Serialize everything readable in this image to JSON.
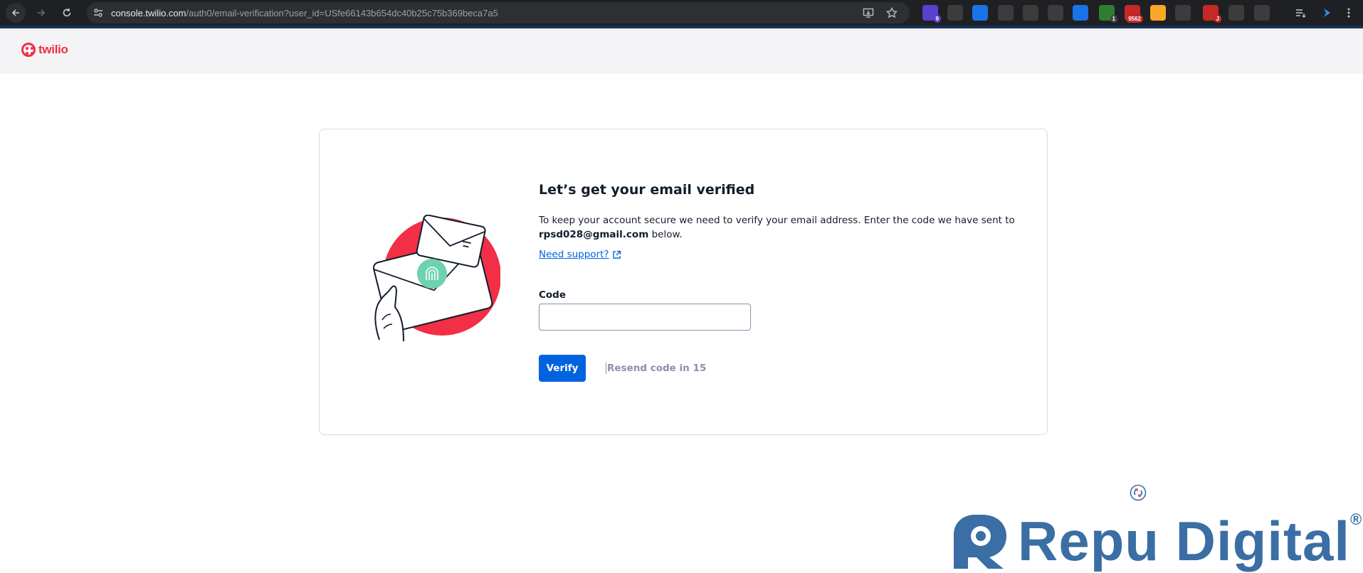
{
  "browser": {
    "url_host": "console.twilio.com",
    "url_path": "/auth0/email-verification?user_id=USfe66143b654dc40b25c75b369beca7a5",
    "extensions": [
      {
        "name": "ext-purple",
        "color": "#5b3fd1",
        "badge": "9",
        "badge_color": "#5b3fd1"
      },
      {
        "name": "ext-gear",
        "color": "#3c3c3c"
      },
      {
        "name": "ext-blue-square",
        "color": "#1a73e8"
      },
      {
        "name": "ext-qr",
        "color": "#3c3c3c"
      },
      {
        "name": "ext-camera",
        "color": "#3c3c3c"
      },
      {
        "name": "ext-1p",
        "color": "#3c3c3c"
      },
      {
        "name": "ext-download",
        "color": "#1a73e8"
      },
      {
        "name": "ext-green",
        "color": "#2e7d32",
        "badge": "1",
        "badge_color": "#444"
      },
      {
        "name": "ext-red",
        "color": "#c62828",
        "badge": "9562",
        "badge_color": "#c62828"
      },
      {
        "name": "ext-colorful",
        "color": "#f9a825"
      },
      {
        "name": "ext-face",
        "color": "#3c3c3c"
      },
      {
        "name": "ext-red-j",
        "color": "#c62828",
        "badge": "J",
        "badge_color": "#c62828"
      },
      {
        "name": "ext-openai",
        "color": "#3c3c3c"
      },
      {
        "name": "ext-puzzle",
        "color": "#3c3c3c"
      }
    ]
  },
  "header": {
    "logo_text": "twilio",
    "brand_color": "#f22f46"
  },
  "card": {
    "title": "Let’s get your email verified",
    "description": "To keep your account secure we need to verify your email address. Enter the code we have sent to",
    "email": "rpsd028@gmail.com",
    "description_suffix": " below.",
    "support_link": "Need support?",
    "code_label": "Code",
    "code_value": "",
    "verify_label": "Verify",
    "resend_label": "Resend code in 15"
  },
  "watermark": {
    "text": "Repu Digital",
    "reg": "®",
    "color": "#3a6ea5"
  }
}
